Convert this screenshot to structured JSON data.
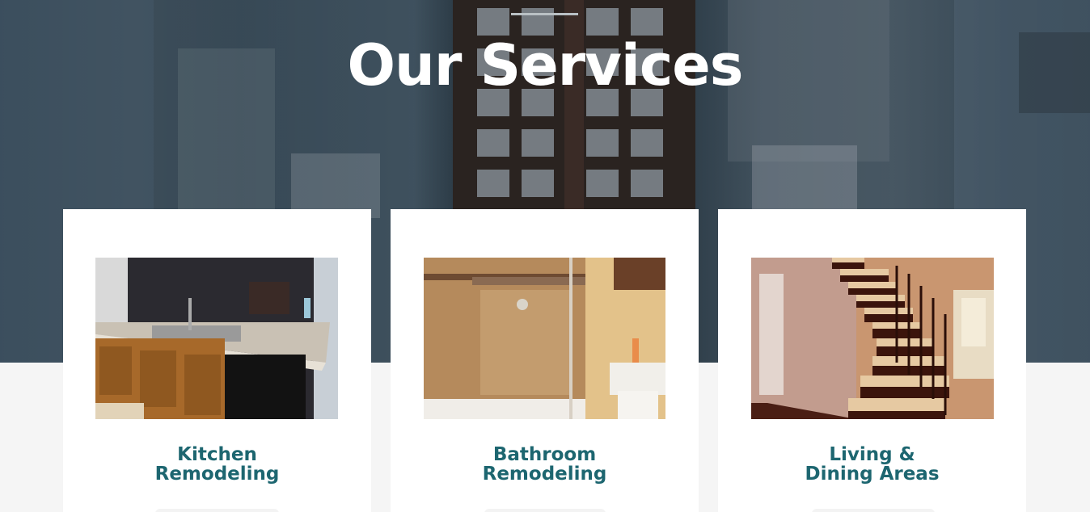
{
  "section": {
    "title": "Our Services"
  },
  "services": [
    {
      "title": "Kitchen Remodeling",
      "image": "kitchen-photo"
    },
    {
      "title": "Bathroom Remodeling",
      "image": "bathroom-photo"
    },
    {
      "title": "Living & Dining Areas",
      "image": "staircase-photo"
    }
  ]
}
